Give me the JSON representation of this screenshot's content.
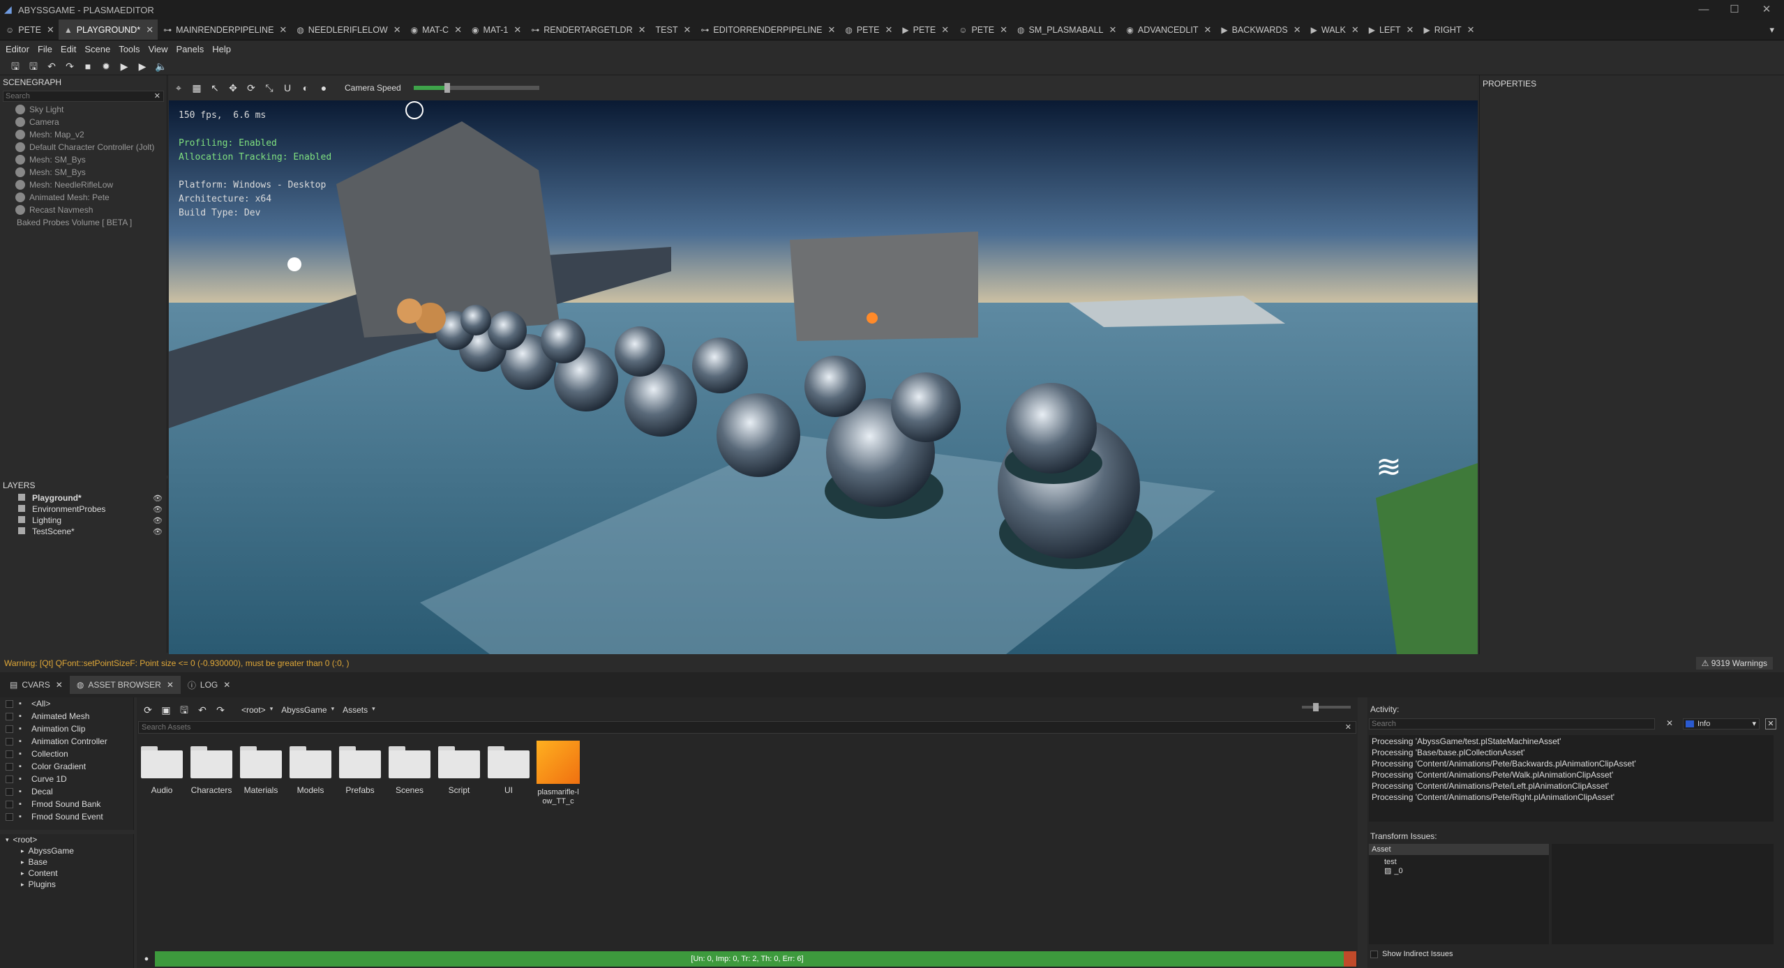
{
  "window": {
    "title": "ABYSSGAME - PLASMAEDITOR"
  },
  "tabs": [
    {
      "label": "PETE",
      "icon": "character-icon",
      "active": false
    },
    {
      "label": "PLAYGROUND*",
      "icon": "scene-icon",
      "active": true
    },
    {
      "label": "MAINRENDERPIPELINE",
      "icon": "graph-icon",
      "active": false
    },
    {
      "label": "NEEDLERIFLELOW",
      "icon": "mesh-icon",
      "active": false
    },
    {
      "label": "MAT-C",
      "icon": "material-icon",
      "active": false
    },
    {
      "label": "MAT-1",
      "icon": "material-icon",
      "active": false
    },
    {
      "label": "RENDERTARGETLDR",
      "icon": "graph-icon",
      "active": false
    },
    {
      "label": "TEST",
      "icon": "",
      "active": false
    },
    {
      "label": "EDITORRENDERPIPELINE",
      "icon": "graph-icon",
      "active": false
    },
    {
      "label": "PETE",
      "icon": "mesh-icon",
      "active": false
    },
    {
      "label": "PETE",
      "icon": "animation-icon",
      "active": false
    },
    {
      "label": "PETE",
      "icon": "character-icon",
      "active": false
    },
    {
      "label": "SM_PLASMABALL",
      "icon": "mesh-icon",
      "active": false
    },
    {
      "label": "ADVANCEDLIT",
      "icon": "material-icon",
      "active": false
    },
    {
      "label": "BACKWARDS",
      "icon": "animation-icon",
      "active": false
    },
    {
      "label": "WALK",
      "icon": "animation-icon",
      "active": false
    },
    {
      "label": "LEFT",
      "icon": "animation-icon",
      "active": false
    },
    {
      "label": "RIGHT",
      "icon": "animation-icon",
      "active": false
    }
  ],
  "menu": [
    "Editor",
    "File",
    "Edit",
    "Scene",
    "Tools",
    "View",
    "Panels",
    "Help"
  ],
  "scenegraph": {
    "title": "SCENEGRAPH",
    "search_placeholder": "Search",
    "items": [
      "Sky Light",
      "Camera",
      "Mesh: Map_v2",
      "Default Character Controller (Jolt)",
      "Mesh: SM_Bys",
      "Mesh: SM_Bys",
      "Mesh: NeedleRifleLow",
      "Animated Mesh: Pete",
      "Recast Navmesh",
      "Baked Probes Volume [ BETA ]"
    ]
  },
  "layers": {
    "title": "LAYERS",
    "items": [
      "Playground*",
      "EnvironmentProbes",
      "Lighting",
      "TestScene*"
    ]
  },
  "viewport": {
    "camera_speed_label": "Camera Speed",
    "camera_speed": 0.27,
    "stats": {
      "fps": "150 fps,  6.6 ms",
      "profiling": "Profiling: Enabled",
      "alloc": "Allocation Tracking: Enabled",
      "platform": "Platform: Windows - Desktop",
      "arch": "Architecture: x64",
      "build": "Build Type: Dev"
    }
  },
  "properties": {
    "title": "PROPERTIES"
  },
  "status": {
    "warning": "Warning: [Qt] QFont::setPointSizeF: Point size <= 0 (-0.930000), must be greater than 0 (:0, )",
    "warnings_count": "9319 Warnings"
  },
  "bottom_tabs": [
    "CVARS",
    "ASSET BROWSER",
    "LOG"
  ],
  "asset_browser": {
    "types": [
      "<All>",
      "Animated Mesh",
      "Animation Clip",
      "Animation Controller",
      "Collection",
      "Color Gradient",
      "Curve 1D",
      "Decal",
      "Fmod Sound Bank",
      "Fmod Sound Event"
    ],
    "tree": [
      "<root>",
      "AbyssGame",
      "Base",
      "Content",
      "Plugins"
    ],
    "breadcrumb": [
      "<root>",
      "AbyssGame",
      "Assets"
    ],
    "search_placeholder": "Search Assets",
    "folders": [
      "Audio",
      "Characters",
      "Materials",
      "Models",
      "Prefabs",
      "Scenes",
      "Script",
      "UI"
    ],
    "file": "plasmarifle-low_TT_c",
    "progress_text": "[Un: 0, Imp: 0, Tr: 2, Th: 0, Err: 6]"
  },
  "activity": {
    "title": "Activity:",
    "search_placeholder": "Search",
    "level": "Info",
    "log": [
      "Processing 'AbyssGame/test.plStateMachineAsset'",
      "Processing 'Base/base.plCollectionAsset'",
      "Processing 'Content/Animations/Pete/Backwards.plAnimationClipAsset'",
      "Processing 'Content/Animations/Pete/Walk.plAnimationClipAsset'",
      "Processing 'Content/Animations/Pete/Left.plAnimationClipAsset'",
      "Processing 'Content/Animations/Pete/Right.plAnimationClipAsset'"
    ],
    "transform_title": "Transform Issues:",
    "col_asset": "Asset",
    "issue_item": "test",
    "issue_sub": "_0",
    "show_indirect": "Show Indirect Issues"
  },
  "colors": {
    "accent": "#6f9be0",
    "warning": "#e0a838",
    "progress": "#3d9a3d",
    "stats_text": "#7fe07f"
  }
}
